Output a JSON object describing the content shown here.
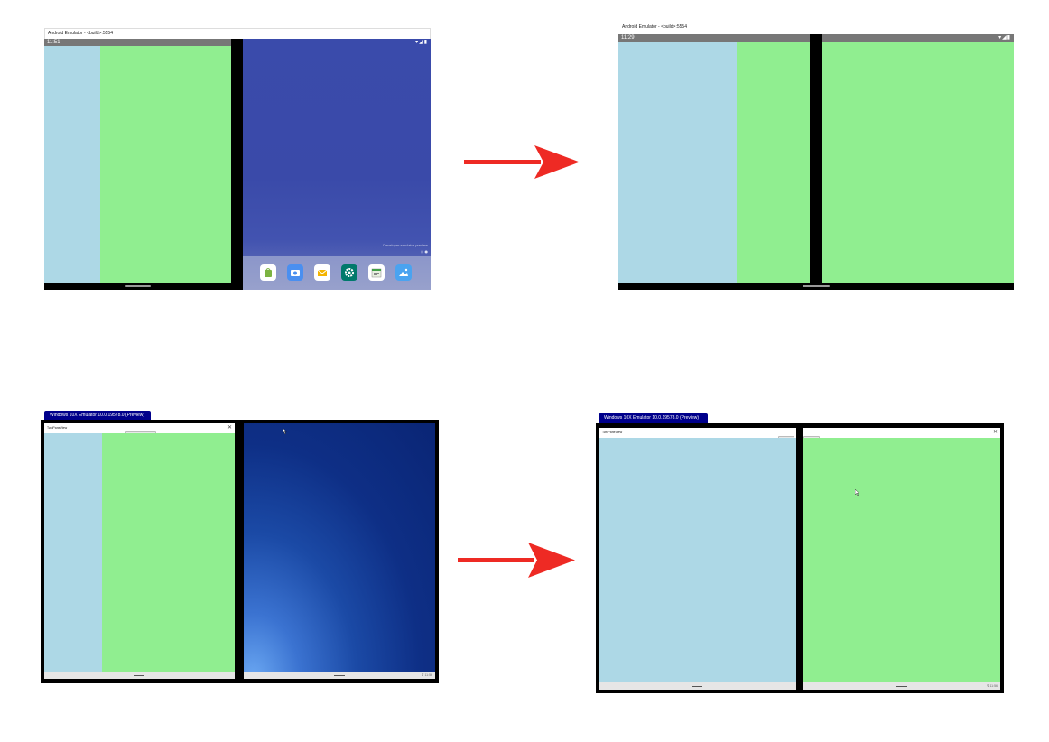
{
  "android_before": {
    "window_title": "Android Emulator - <build>:5554",
    "status_time": "11:51",
    "status_icons": "▾◢▮",
    "developer_preview_text": "Developer emulator preview",
    "page_dots": "○ ●",
    "dock_icons": [
      "store-icon",
      "camera-icon",
      "email-icon",
      "settings-icon",
      "calendar-icon",
      "photos-icon"
    ]
  },
  "android_after": {
    "window_title": "Android Emulator - <build>:5554",
    "status_time": "11:29",
    "status_icons": "▾◢▮"
  },
  "windows_before": {
    "tab_title": "Windows 10X Emulator 10.0.19578.0 (Preview)",
    "app_title": "TwoPaneView",
    "close_glyph": "✕",
    "tray_text": "⊽  11:56"
  },
  "windows_after": {
    "tab_title": "Windows 10X Emulator 10.0.19578.0 (Preview)",
    "app_title": "TwoPaneView",
    "close_glyph": "✕",
    "tray_text": "⊽  11:56"
  },
  "colors": {
    "pane_blue": "#add8e6",
    "pane_green": "#90ee90",
    "arrow_red": "#ee2a24",
    "windows_tab": "#00008b",
    "android_launcher": "#3a4bab"
  }
}
